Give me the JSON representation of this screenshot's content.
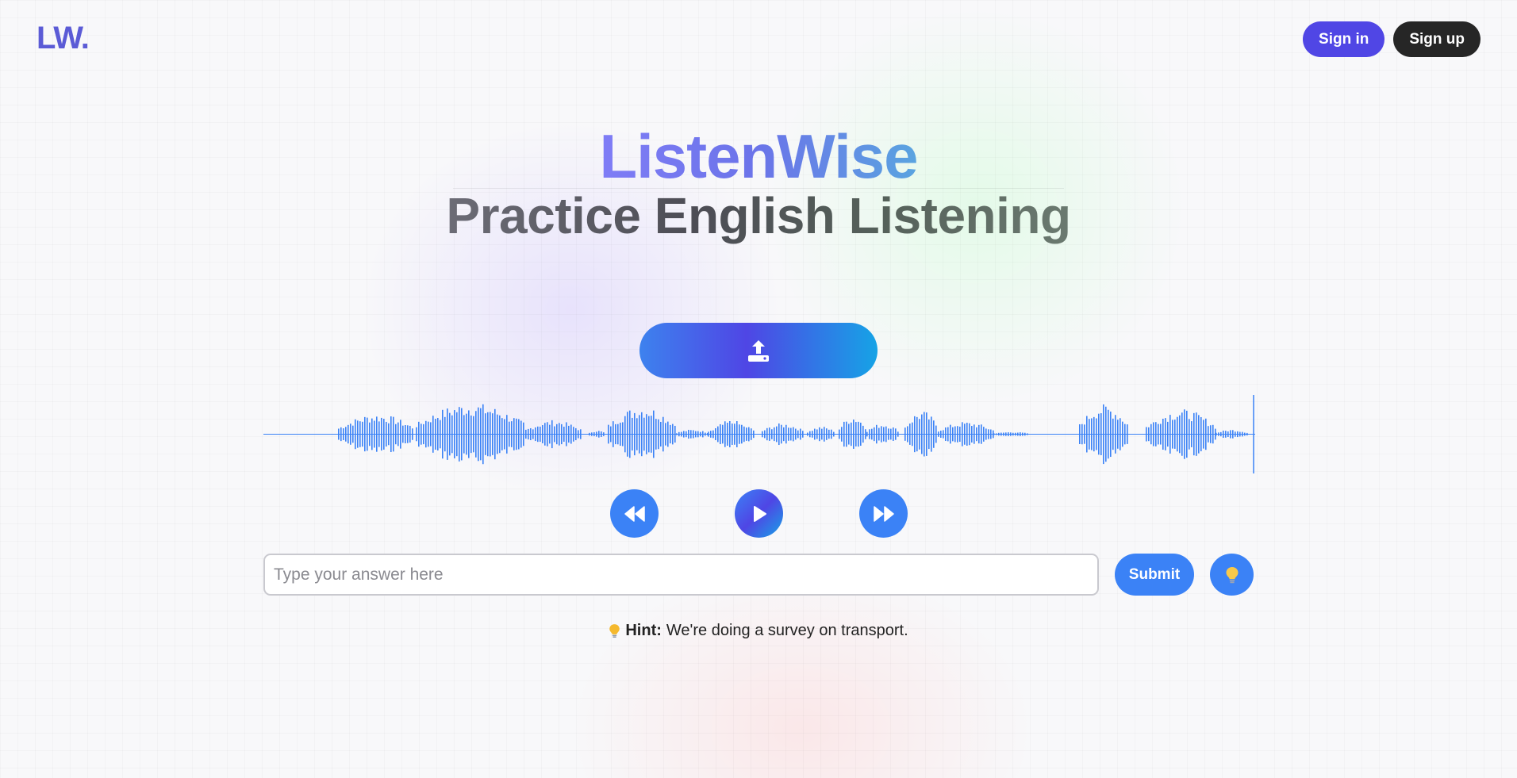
{
  "brand": {
    "logo": "LW."
  },
  "header": {
    "signin_label": "Sign in",
    "signup_label": "Sign up"
  },
  "hero": {
    "title": "ListenWise",
    "subtitle": "Practice English Listening"
  },
  "upload": {
    "icon": "upload-icon"
  },
  "player": {
    "rewind_icon": "rewind-icon",
    "play_icon": "play-icon",
    "forward_icon": "fast-forward-icon",
    "waveform_color": "#3b82f6"
  },
  "answer": {
    "placeholder": "Type your answer here",
    "value": ""
  },
  "actions": {
    "submit_label": "Submit",
    "hint_icon": "lightbulb-icon"
  },
  "hint": {
    "label": "Hint:",
    "text": "We're doing a survey on transport."
  },
  "colors": {
    "accent": "#5046e5",
    "primary_blue": "#3b82f6",
    "dark": "#262626"
  }
}
